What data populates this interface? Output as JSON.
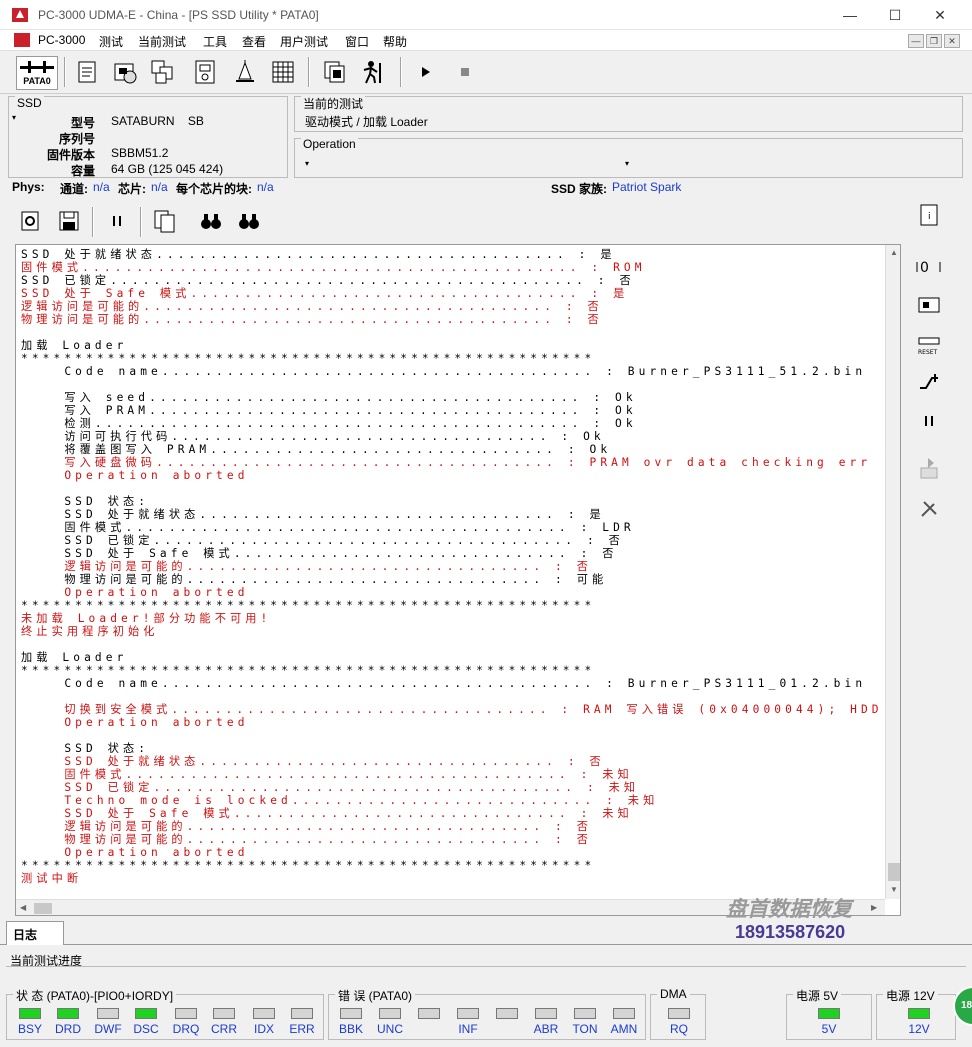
{
  "window": {
    "title": "PC-3000 UDMA-E - China - [PS SSD Utility * PATA0]",
    "controls": [
      "—",
      "☐",
      "✕"
    ]
  },
  "menu": {
    "items": [
      "PC-3000",
      "测试",
      "当前测试",
      "工具",
      "查看",
      "用户测试",
      "窗口",
      "帮助"
    ],
    "mdi": [
      "—",
      "❐",
      "✕"
    ]
  },
  "toolbar": {
    "pata_label": "PATA0",
    "icons": [
      "scroll-icon",
      "chip-settings-icon",
      "multi-chip-icon",
      "board-icon",
      "scale-icon",
      "grid-icon",
      "copy-stack-icon",
      "run-man-icon",
      "play-icon",
      "stop-icon"
    ]
  },
  "ssd": {
    "group_label": "SSD",
    "model_label": "型号",
    "model_value": "SATABURN    SB",
    "serial_label": "序列号",
    "serial_value": "",
    "firmware_label": "固件版本",
    "firmware_value": "SBBM51.2",
    "capacity_label": "容量",
    "capacity_value": "64 GB (125 045 424)"
  },
  "current_test": {
    "group_label": "当前的测试",
    "value": "驱动模式 / 加载 Loader"
  },
  "operation": {
    "group_label": "Operation",
    "value": ""
  },
  "phys": {
    "label": "Phys:",
    "channel_label": "通道:",
    "channel_value": "n/a",
    "chip_label": "芯片:",
    "chip_value": "n/a",
    "blocks_label": "每个芯片的块:",
    "blocks_value": "n/a",
    "family_label": "SSD 家族:",
    "family_value": "Patriot Spark"
  },
  "log": {
    "lines": [
      {
        "t": "SSD 处于就绪状态...................................... : 是",
        "red": false
      },
      {
        "t": "固件模式.............................................. : ROM",
        "red": true
      },
      {
        "t": "SSD 已锁定............................................ : 否",
        "red": false
      },
      {
        "t": "SSD 处于 Safe 模式.................................... : 是",
        "red": true
      },
      {
        "t": "逻辑访问是可能的...................................... : 否",
        "red": true
      },
      {
        "t": "物理访问是可能的...................................... : 否",
        "red": true
      },
      {
        "t": "",
        "red": false
      },
      {
        "t": "加载 Loader",
        "red": false
      },
      {
        "t": "*****************************************************",
        "red": false
      },
      {
        "t": "    Code name........................................ : Burner_PS3111_51.2.bin",
        "red": false
      },
      {
        "t": "",
        "red": false
      },
      {
        "t": "    写入 seed........................................ : Ok",
        "red": false
      },
      {
        "t": "    写入 PRAM........................................ : Ok",
        "red": false
      },
      {
        "t": "    检测............................................. : Ok",
        "red": false
      },
      {
        "t": "    访问可执行代码................................... : Ok",
        "red": false
      },
      {
        "t": "    将覆盖图写入 PRAM................................ : Ok",
        "red": false
      },
      {
        "t": "    写入硬盘微码..................................... : PRAM ovr data checking err",
        "red": true
      },
      {
        "t": "    Operation aborted",
        "red": true
      },
      {
        "t": "",
        "red": false
      },
      {
        "t": "    SSD 状态:",
        "red": false
      },
      {
        "t": "    SSD 处于就绪状态................................. : 是",
        "red": false
      },
      {
        "t": "    固件模式......................................... : LDR",
        "red": false
      },
      {
        "t": "    SSD 已锁定....................................... : 否",
        "red": false
      },
      {
        "t": "    SSD 处于 Safe 模式............................... : 否",
        "red": false
      },
      {
        "t": "    逻辑访问是可能的................................. : 否",
        "red": true
      },
      {
        "t": "    物理访问是可能的................................. : 可能",
        "red": false
      },
      {
        "t": "    Operation aborted",
        "red": true
      },
      {
        "t": "*****************************************************",
        "red": false
      },
      {
        "t": "未加载 Loader!部分功能不可用!",
        "red": true
      },
      {
        "t": "终止实用程序初始化",
        "red": true
      },
      {
        "t": "",
        "red": false
      },
      {
        "t": "加载 Loader",
        "red": false
      },
      {
        "t": "*****************************************************",
        "red": false
      },
      {
        "t": "    Code name........................................ : Burner_PS3111_01.2.bin",
        "red": false
      },
      {
        "t": "",
        "red": false
      },
      {
        "t": "    切换到安全模式................................... : RAM 写入错误 (0x04000044); HDD",
        "red": true
      },
      {
        "t": "    Operation aborted",
        "red": true
      },
      {
        "t": "",
        "red": false
      },
      {
        "t": "    SSD 状态:",
        "red": false
      },
      {
        "t": "    SSD 处于就绪状态................................. : 否",
        "red": true
      },
      {
        "t": "    固件模式......................................... : 未知",
        "red": true
      },
      {
        "t": "    SSD 已锁定....................................... : 未知",
        "red": true
      },
      {
        "t": "    Techno mode is locked............................ : 未知",
        "red": true
      },
      {
        "t": "    SSD 处于 Safe 模式............................... : 未知",
        "red": true
      },
      {
        "t": "    逻辑访问是可能的................................. : 否",
        "red": true
      },
      {
        "t": "    物理访问是可能的................................. : 否",
        "red": true
      },
      {
        "t": "    Operation aborted",
        "red": true
      },
      {
        "t": "*****************************************************",
        "red": false
      },
      {
        "t": "测试中断",
        "red": true
      }
    ]
  },
  "watermark": {
    "line1": "盘首数据恢复",
    "line2": "18913587620"
  },
  "tabs": {
    "log": "日志"
  },
  "progress": {
    "label": "当前测试进度"
  },
  "status": {
    "state_group": "状 态 (PATA0)-[PIO0+IORDY]",
    "state_leds": [
      {
        "label": "BSY",
        "on": true
      },
      {
        "label": "DRD",
        "on": true
      },
      {
        "label": "DWF",
        "on": false
      },
      {
        "label": "DSC",
        "on": true
      },
      {
        "label": "DRQ",
        "on": false
      },
      {
        "label": "CRR",
        "on": false
      },
      {
        "label": "IDX",
        "on": false
      },
      {
        "label": "ERR",
        "on": false
      }
    ],
    "error_group": "错 误 (PATA0)",
    "error_leds": [
      {
        "label": "BBK",
        "on": false
      },
      {
        "label": "UNC",
        "on": false
      },
      {
        "label": "",
        "on": false
      },
      {
        "label": "INF",
        "on": false
      },
      {
        "label": "",
        "on": false
      },
      {
        "label": "ABR",
        "on": false
      },
      {
        "label": "TON",
        "on": false
      },
      {
        "label": "AMN",
        "on": false
      }
    ],
    "dma_group": "DMA",
    "dma_leds": [
      {
        "label": "RQ",
        "on": false
      }
    ],
    "p5_group": "电源 5V",
    "p5_leds": [
      {
        "label": "5V",
        "on": true
      }
    ],
    "p12_group": "电源 12V",
    "p12_leds": [
      {
        "label": "12V",
        "on": true
      }
    ]
  },
  "badge": "18",
  "colors": {
    "log_red": "#d01010",
    "link_blue": "#1a3bd0",
    "led_on": "#1fd121",
    "brand_red": "#c9202a"
  }
}
